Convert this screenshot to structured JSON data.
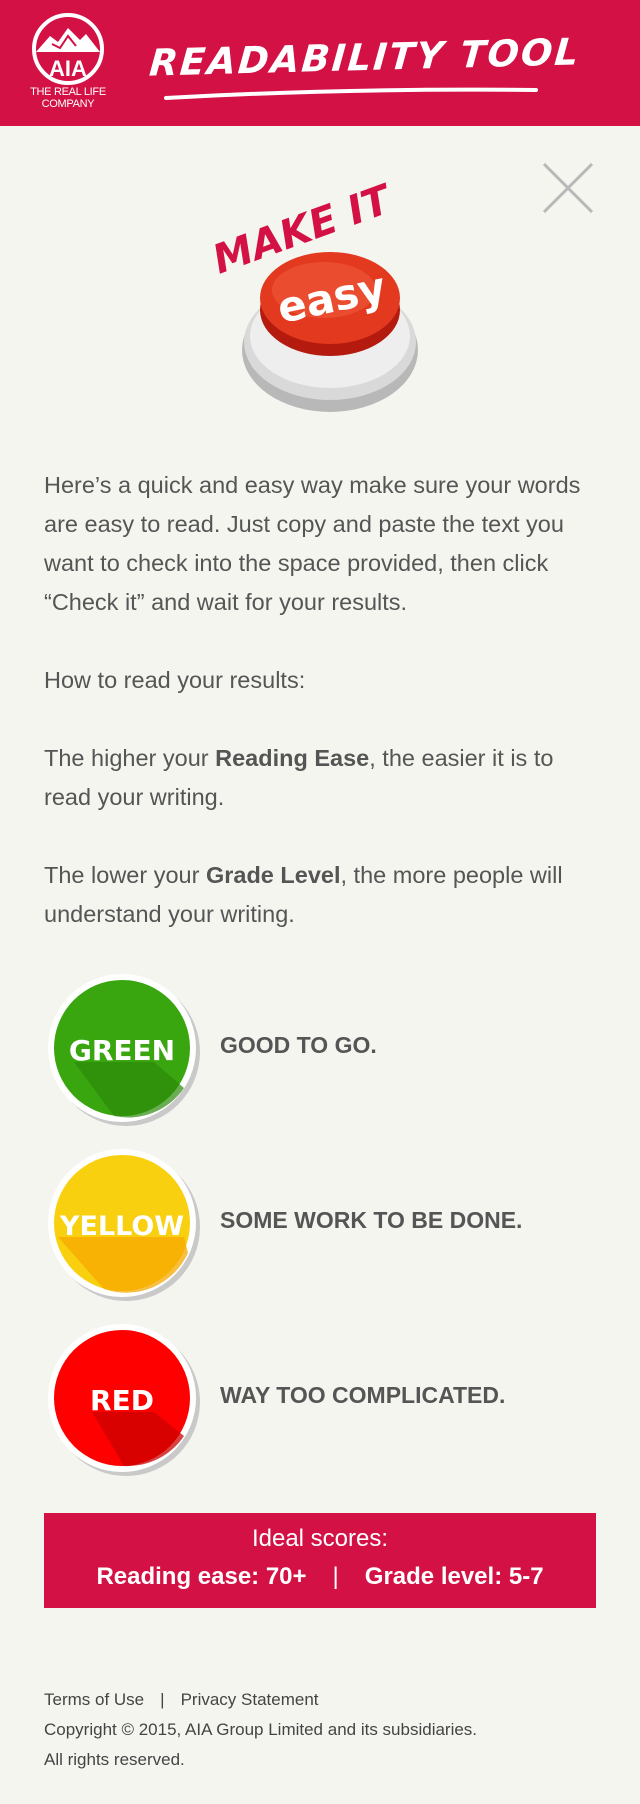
{
  "header": {
    "logo_name": "AIA",
    "logo_tagline_line1": "THE REAL LIFE",
    "logo_tagline_line2": "COMPANY",
    "title": "READABILITY TOOL",
    "background_color": "#d31145"
  },
  "hero": {
    "make_it": "MAKE IT",
    "button_label": "easy"
  },
  "intro": {
    "paragraph1": "Here’s a quick and easy way make sure your words are easy to read. Just copy and paste the text you want to check into the space provided, then click “Check it” and wait for your results.",
    "how_to_read": "How to read your results:",
    "reading_ease_prefix": "The higher your ",
    "reading_ease_term": "Reading Ease",
    "reading_ease_suffix": ", the easier it is to read your writing.",
    "grade_level_prefix": "The lower your ",
    "grade_level_term": "Grade Level",
    "grade_level_suffix": ", the more people will understand your writing."
  },
  "legend": [
    {
      "label": "GREEN",
      "description": "GOOD TO GO.",
      "color": "#3aa60f"
    },
    {
      "label": "YELLOW",
      "description": "SOME WORK TO BE DONE.",
      "color": "#f9d00f"
    },
    {
      "label": "RED",
      "description": "WAY TOO COMPLICATED.",
      "color": "#ff0000"
    }
  ],
  "ideal": {
    "title": "Ideal scores:",
    "reading_ease": "Reading ease: 70+",
    "separator": "|",
    "grade_level": "Grade level: 5-7"
  },
  "footer": {
    "terms": "Terms of Use",
    "separator": "|",
    "privacy": "Privacy Statement",
    "copyright": "Copyright © 2015, AIA Group Limited and its subsidiaries.",
    "rights": "All rights reserved."
  }
}
